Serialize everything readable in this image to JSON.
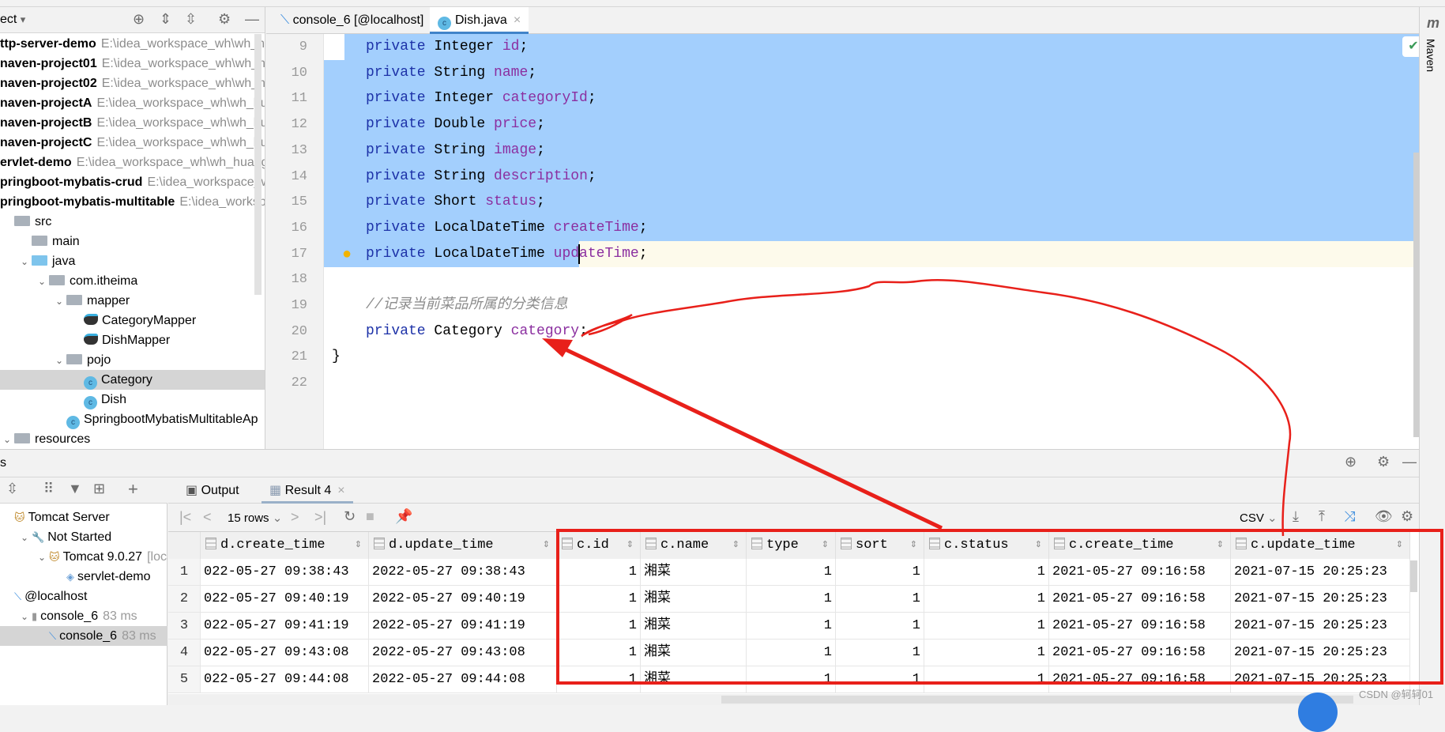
{
  "project_panel": {
    "title": "ect",
    "title_dropdown": "▾",
    "items": [
      {
        "name": "ttp-server-demo",
        "path": "E:\\idea_workspace_wh\\wh_h",
        "level": 0,
        "bold": true
      },
      {
        "name": "naven-project01",
        "path": "E:\\idea_workspace_wh\\wh_hu",
        "level": 0,
        "bold": true
      },
      {
        "name": "naven-project02",
        "path": "E:\\idea_workspace_wh\\wh_hu",
        "level": 0,
        "bold": true
      },
      {
        "name": "naven-projectA",
        "path": "E:\\idea_workspace_wh\\wh_hua",
        "level": 0,
        "bold": true
      },
      {
        "name": "naven-projectB",
        "path": "E:\\idea_workspace_wh\\wh_hua",
        "level": 0,
        "bold": true
      },
      {
        "name": "naven-projectC",
        "path": "E:\\idea_workspace_wh\\wh_hua",
        "level": 0,
        "bold": true
      },
      {
        "name": "ervlet-demo",
        "path": "E:\\idea_workspace_wh\\wh_huang",
        "level": 0,
        "bold": true
      },
      {
        "name": "pringboot-mybatis-crud",
        "path": "E:\\idea_workspace_w",
        "level": 0,
        "bold": true
      },
      {
        "name": "pringboot-mybatis-multitable",
        "path": "E:\\idea_worksp",
        "level": 0,
        "bold": true
      },
      {
        "name": "src",
        "icon": "folder",
        "level": 0
      },
      {
        "name": "main",
        "icon": "folder",
        "level": 1
      },
      {
        "name": "java",
        "icon": "folder-blue",
        "level": 1,
        "expanded": true
      },
      {
        "name": "com.itheima",
        "icon": "package",
        "level": 2,
        "expanded": true
      },
      {
        "name": "mapper",
        "icon": "package",
        "level": 3,
        "expanded": true
      },
      {
        "name": "CategoryMapper",
        "icon": "mybatis",
        "level": 4
      },
      {
        "name": "DishMapper",
        "icon": "mybatis",
        "level": 4
      },
      {
        "name": "pojo",
        "icon": "package",
        "level": 3,
        "expanded": true
      },
      {
        "name": "Category",
        "icon": "class",
        "level": 4,
        "selected": true
      },
      {
        "name": "Dish",
        "icon": "class",
        "level": 4
      },
      {
        "name": "SpringbootMybatisMultitableAp",
        "icon": "spring-app",
        "level": 3
      },
      {
        "name": "resources",
        "icon": "folder",
        "level": 0,
        "expanded": true
      }
    ]
  },
  "editor_tabs": [
    {
      "label": "console_6 [@localhost]",
      "icon": "sql-icon",
      "active": false
    },
    {
      "label": "Dish.java",
      "icon": "class-icon",
      "active": true
    }
  ],
  "editor": {
    "lines": [
      {
        "n": "9",
        "parts": [
          [
            "kw",
            "private "
          ],
          [
            "",
            "Integer "
          ],
          [
            "fld",
            "id"
          ],
          [
            "",
            ";"
          ]
        ]
      },
      {
        "n": "10",
        "parts": [
          [
            "kw",
            "private "
          ],
          [
            "",
            "String "
          ],
          [
            "fld",
            "name"
          ],
          [
            "",
            ";"
          ]
        ]
      },
      {
        "n": "11",
        "parts": [
          [
            "kw",
            "private "
          ],
          [
            "",
            "Integer "
          ],
          [
            "fld",
            "categoryId"
          ],
          [
            "",
            ";"
          ]
        ]
      },
      {
        "n": "12",
        "parts": [
          [
            "kw",
            "private "
          ],
          [
            "",
            "Double "
          ],
          [
            "fld",
            "price"
          ],
          [
            "",
            ";"
          ]
        ]
      },
      {
        "n": "13",
        "parts": [
          [
            "kw",
            "private "
          ],
          [
            "",
            "String "
          ],
          [
            "fld",
            "image"
          ],
          [
            "",
            ";"
          ]
        ]
      },
      {
        "n": "14",
        "parts": [
          [
            "kw",
            "private "
          ],
          [
            "",
            "String "
          ],
          [
            "fld",
            "description"
          ],
          [
            "",
            ";"
          ]
        ]
      },
      {
        "n": "15",
        "parts": [
          [
            "kw",
            "private "
          ],
          [
            "",
            "Short "
          ],
          [
            "fld",
            "status"
          ],
          [
            "",
            ";"
          ]
        ]
      },
      {
        "n": "16",
        "parts": [
          [
            "kw",
            "private "
          ],
          [
            "",
            "LocalDateTime "
          ],
          [
            "fld",
            "createTime"
          ],
          [
            "",
            ";"
          ]
        ]
      },
      {
        "n": "17",
        "parts": [
          [
            "kw",
            "private "
          ],
          [
            "",
            "LocalDateTime "
          ],
          [
            "fld",
            "updateTime"
          ],
          [
            "",
            ";"
          ]
        ]
      },
      {
        "n": "18",
        "parts": []
      },
      {
        "n": "19",
        "parts": [
          [
            "cm",
            "//记录当前菜品所属的分类信息"
          ]
        ]
      },
      {
        "n": "20",
        "parts": [
          [
            "kw",
            "private "
          ],
          [
            "",
            "Category "
          ],
          [
            "fld",
            "category"
          ],
          [
            "",
            ";"
          ]
        ]
      },
      {
        "n": "21",
        "parts": [
          [
            "",
            "}"
          ]
        ],
        "indent": 0
      },
      {
        "n": "22",
        "parts": []
      }
    ]
  },
  "maven_label": "Maven",
  "bottom": {
    "header_label": "s",
    "services_tree": [
      {
        "label": "Tomcat Server",
        "level": 0,
        "icon": "tomcat-icon"
      },
      {
        "label": "Not Started",
        "level": 1,
        "icon": "wrench-icon",
        "expanded": true
      },
      {
        "label": "Tomcat 9.0.27",
        "extra": "[loca",
        "level": 2,
        "icon": "tomcat-icon",
        "expanded": true
      },
      {
        "label": "servlet-demo",
        "level": 3,
        "icon": "artifact-icon"
      },
      {
        "label": "@localhost",
        "level": 0,
        "icon": "sql-icon"
      },
      {
        "label": "console_6",
        "ms": "83 ms",
        "level": 1,
        "icon": "console-icon",
        "expanded": true
      },
      {
        "label": "console_6",
        "ms": "83 ms",
        "level": 2,
        "icon": "sql-icon",
        "selected": true
      }
    ],
    "tabs": [
      {
        "label": "Output",
        "icon": "output-icon"
      },
      {
        "label": "Result 4",
        "icon": "table-icon",
        "active": true
      }
    ],
    "rows_label": "15 rows",
    "export_format": "CSV",
    "columns": [
      "",
      "d.create_time",
      "d.update_time",
      "c.id",
      "c.name",
      "type",
      "sort",
      "c.status",
      "c.create_time",
      "c.update_time"
    ],
    "rows": [
      [
        "1",
        "022-05-27 09:38:43",
        "2022-05-27 09:38:43",
        "1",
        "湘菜",
        "1",
        "1",
        "1",
        "2021-05-27 09:16:58",
        "2021-07-15 20:25:23"
      ],
      [
        "2",
        "022-05-27 09:40:19",
        "2022-05-27 09:40:19",
        "1",
        "湘菜",
        "1",
        "1",
        "1",
        "2021-05-27 09:16:58",
        "2021-07-15 20:25:23"
      ],
      [
        "3",
        "022-05-27 09:41:19",
        "2022-05-27 09:41:19",
        "1",
        "湘菜",
        "1",
        "1",
        "1",
        "2021-05-27 09:16:58",
        "2021-07-15 20:25:23"
      ],
      [
        "4",
        "022-05-27 09:43:08",
        "2022-05-27 09:43:08",
        "1",
        "湘菜",
        "1",
        "1",
        "1",
        "2021-05-27 09:16:58",
        "2021-07-15 20:25:23"
      ],
      [
        "5",
        "022-05-27 09:44:08",
        "2022-05-27 09:44:08",
        "1",
        "湘菜",
        "1",
        "1",
        "1",
        "2021-05-27 09:16:58",
        "2021-07-15 20:25:23"
      ]
    ]
  },
  "watermark": "CSDN @轲轲01",
  "colors": {
    "selection": "#a3cffd",
    "annotation": "#e8201a",
    "accent": "#4083c9"
  }
}
